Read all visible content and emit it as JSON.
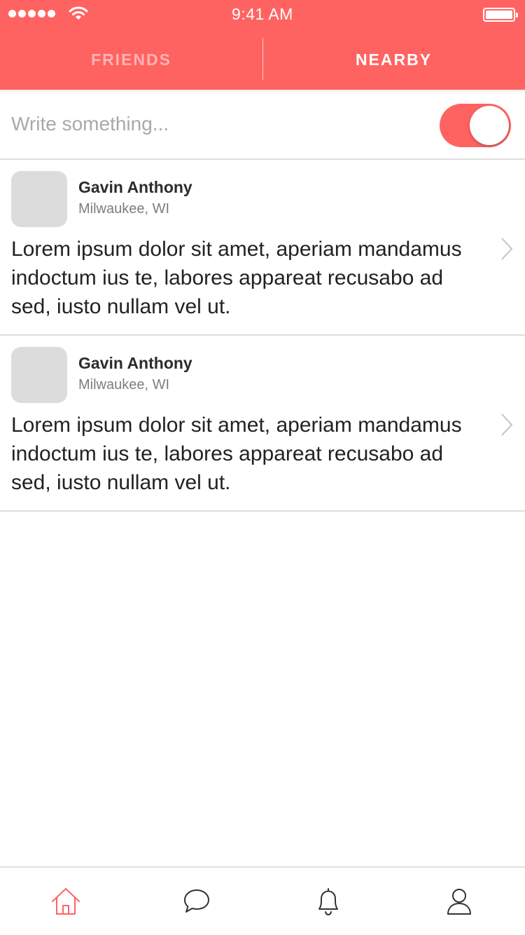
{
  "status_bar": {
    "time": "9:41 AM"
  },
  "top_tabs": [
    {
      "label": "FRIENDS",
      "active": false
    },
    {
      "label": "NEARBY",
      "active": true
    }
  ],
  "compose": {
    "placeholder": "Write something...",
    "value": "",
    "toggle_on": true
  },
  "posts": [
    {
      "name": "Gavin Anthony",
      "location": "Milwaukee, WI",
      "body": "Lorem ipsum dolor sit amet, aperiam mandamus indoctum ius te, labores appareat recusabo ad sed, iusto nullam vel ut."
    },
    {
      "name": "Gavin Anthony",
      "location": "Milwaukee, WI",
      "body": "Lorem ipsum dolor sit amet, aperiam mandamus indoctum ius te, labores appareat recusabo ad sed, iusto nullam vel ut."
    }
  ],
  "tab_bar": [
    {
      "icon": "home-icon",
      "active": true
    },
    {
      "icon": "chat-bubble-icon",
      "active": false
    },
    {
      "icon": "bell-icon",
      "active": false
    },
    {
      "icon": "user-icon",
      "active": false
    }
  ],
  "colors": {
    "accent": "#ff6361",
    "inactive_tab_text": "#ffb3b2",
    "divider": "#dcdcdc",
    "avatar_placeholder": "#dcdcdc"
  }
}
